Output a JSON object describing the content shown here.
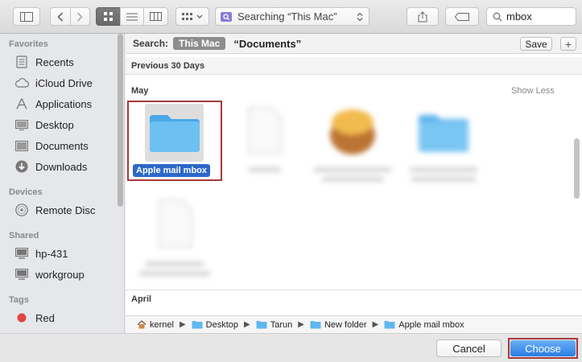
{
  "toolbar": {
    "location_title": "Searching “This Mac”",
    "search_value": "mbox"
  },
  "sidebar": {
    "sections": [
      {
        "title": "Favorites",
        "items": [
          {
            "label": "Recents",
            "icon": "recents-icon"
          },
          {
            "label": "iCloud Drive",
            "icon": "cloud-icon"
          },
          {
            "label": "Applications",
            "icon": "applications-icon"
          },
          {
            "label": "Desktop",
            "icon": "desktop-icon"
          },
          {
            "label": "Documents",
            "icon": "documents-icon"
          },
          {
            "label": "Downloads",
            "icon": "downloads-icon"
          }
        ]
      },
      {
        "title": "Devices",
        "items": [
          {
            "label": "Remote Disc",
            "icon": "disc-icon"
          }
        ]
      },
      {
        "title": "Shared",
        "items": [
          {
            "label": "hp-431",
            "icon": "computer-icon"
          },
          {
            "label": "workgroup",
            "icon": "computer-icon"
          }
        ]
      },
      {
        "title": "Tags",
        "items": [
          {
            "label": "Red",
            "icon": "red-tag-icon",
            "color": "#e0443e"
          }
        ]
      }
    ]
  },
  "search_scope": {
    "label": "Search:",
    "active": "This Mac",
    "inactive": "“Documents”",
    "save_label": "Save",
    "add_label": "+"
  },
  "results": {
    "section_title": "Previous 30 Days",
    "group_may": "May",
    "show_less": "Show Less",
    "group_april": "April",
    "selected_item": "Apple mail mbox"
  },
  "path_bar": {
    "crumbs": [
      {
        "label": "kernel",
        "icon": "home-icon"
      },
      {
        "label": "Desktop",
        "icon": "folder-icon"
      },
      {
        "label": "Tarun",
        "icon": "folder-icon"
      },
      {
        "label": "New folder",
        "icon": "folder-icon"
      },
      {
        "label": "Apple mail mbox",
        "icon": "folder-icon"
      }
    ]
  },
  "footer": {
    "cancel_label": "Cancel",
    "choose_label": "Choose"
  },
  "colors": {
    "accent": "#2c67c9",
    "folder": "#5fb7ef",
    "highlight_border": "#a63a3a"
  }
}
